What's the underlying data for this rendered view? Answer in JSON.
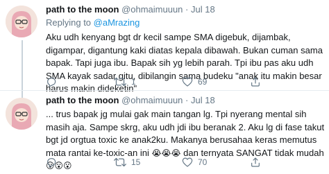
{
  "tweets": [
    {
      "name": "path to the moon",
      "handle": "@ohmaimuuun",
      "separator": "·",
      "date": "Jul 18",
      "reply_prefix": "Replying to",
      "reply_mention": "@aMrazing",
      "text": "Aku udh kenyang bgt dr kecil sampe SMA digebuk, dijambak, digampar, digantung kaki diatas kepala dibawah. Bukan cuman sama bapak. Tapi juga ibu. Bapak sih yg lebih parah. Tpi ibu pas aku udh SMA kayak sadar gitu, dibilangin sama budeku \"anak itu makin besar harus makin dideketin\"",
      "replies": "",
      "retweets": "1",
      "likes": "69"
    },
    {
      "name": "path to the moon",
      "handle": "@ohmaimuuun",
      "separator": "·",
      "date": "Jul 18",
      "text_main": "... trus bapak jg mulai gak main tangan lg. Tpi nyerang mental sih masih aja. Sampe skrg, aku udh jdi ibu beranak 2. Aku lg di fase takut bgt jd orgtua toxic ke anak2ku. Makanya berusahaa keras memutus mata rantai ke-toxic-an ini ",
      "emoji_cry": "😭😭😭",
      "text_mid": " dan ternyata SANGAT tidak mudah",
      "emoji_wow": "😮😮😮",
      "replies": "",
      "retweets": "15",
      "likes": "70"
    }
  ],
  "icons": {
    "reply": "reply-icon",
    "retweet": "retweet-icon",
    "like": "heart-icon"
  },
  "colors": {
    "link": "#1b95e0",
    "secondary_text": "#657786",
    "thread_line": "#c9d3da",
    "divider": "#e6ecf0"
  }
}
